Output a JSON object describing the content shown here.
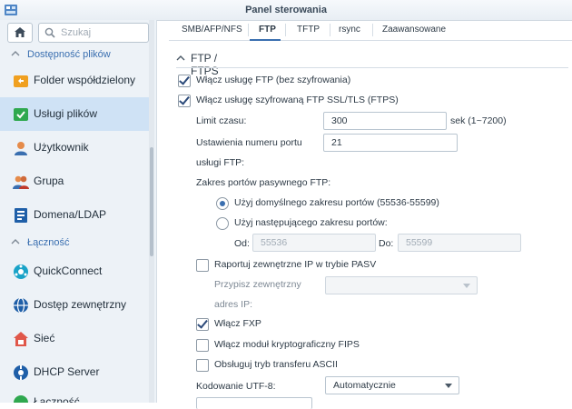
{
  "window": {
    "title": "Panel sterowania"
  },
  "sidebar": {
    "search_placeholder": "Szukaj",
    "sections": [
      {
        "label": "Dostępność plików"
      },
      {
        "label": "Łączność"
      }
    ],
    "items": [
      {
        "label": "Folder współdzielony",
        "icon": "shared-folder-icon"
      },
      {
        "label": "Usługi plików",
        "icon": "file-services-icon",
        "active": true
      },
      {
        "label": "Użytkownik",
        "icon": "user-icon"
      },
      {
        "label": "Grupa",
        "icon": "group-icon"
      },
      {
        "label": "Domena/LDAP",
        "icon": "domain-ldap-icon"
      },
      {
        "label": "QuickConnect",
        "icon": "quickconnect-icon"
      },
      {
        "label": "Dostęp zewnętrzny",
        "icon": "external-access-icon"
      },
      {
        "label": "Sieć",
        "icon": "network-icon"
      },
      {
        "label": "DHCP Server",
        "icon": "dhcp-server-icon"
      },
      {
        "label": "Łączność",
        "icon": "connectivity-icon"
      }
    ]
  },
  "tabs": [
    {
      "label": "SMB/AFP/NFS"
    },
    {
      "label": "FTP",
      "active": true
    },
    {
      "label": "TFTP"
    },
    {
      "label": "rsync"
    },
    {
      "label": "Zaawansowane"
    }
  ],
  "ftp": {
    "section_title": "FTP / FTPS",
    "enable_ftp": {
      "label": "Włącz usługę FTP (bez szyfrowania)",
      "checked": true
    },
    "enable_ftps": {
      "label": "Włącz usługę szyfrowaną FTP SSL/TLS (FTPS)",
      "checked": true
    },
    "timeout": {
      "label": "Limit czasu:",
      "value": "300",
      "suffix": "sek (1~7200)"
    },
    "port": {
      "label_line1": "Ustawienia numeru portu",
      "label_line2": "usługi FTP:",
      "value": "21"
    },
    "passive_range_label": "Zakres portów pasywnego FTP:",
    "default_range": {
      "label": "Użyj domyślnego zakresu portów (55536-55599)",
      "selected": true
    },
    "custom_range": {
      "label": "Użyj następującego zakresu portów:",
      "selected": false
    },
    "from": {
      "label": "Od:",
      "value": "55536"
    },
    "to": {
      "label": "Do:",
      "value": "55599"
    },
    "report_external_ip": {
      "label": "Raportuj zewnętrzne IP w trybie PASV",
      "checked": false
    },
    "assign_external_ip": {
      "label_line1": "Przypisz zewnętrzny",
      "label_line2": "adres IP:",
      "value": ""
    },
    "enable_fxp": {
      "label": "Włącz FXP",
      "checked": true
    },
    "enable_fips": {
      "label": "Włącz moduł kryptograficzny FIPS",
      "checked": false
    },
    "ascii_mode": {
      "label": "Obsługuj tryb transferu ASCII",
      "checked": false
    },
    "utf8": {
      "label": "Kodowanie UTF-8:",
      "value": "Automatycznie"
    }
  },
  "colors": {
    "accent": "#3a6fb0",
    "sidebar_bg": "#edf2f7",
    "active_item_bg": "#cfe2f5"
  }
}
